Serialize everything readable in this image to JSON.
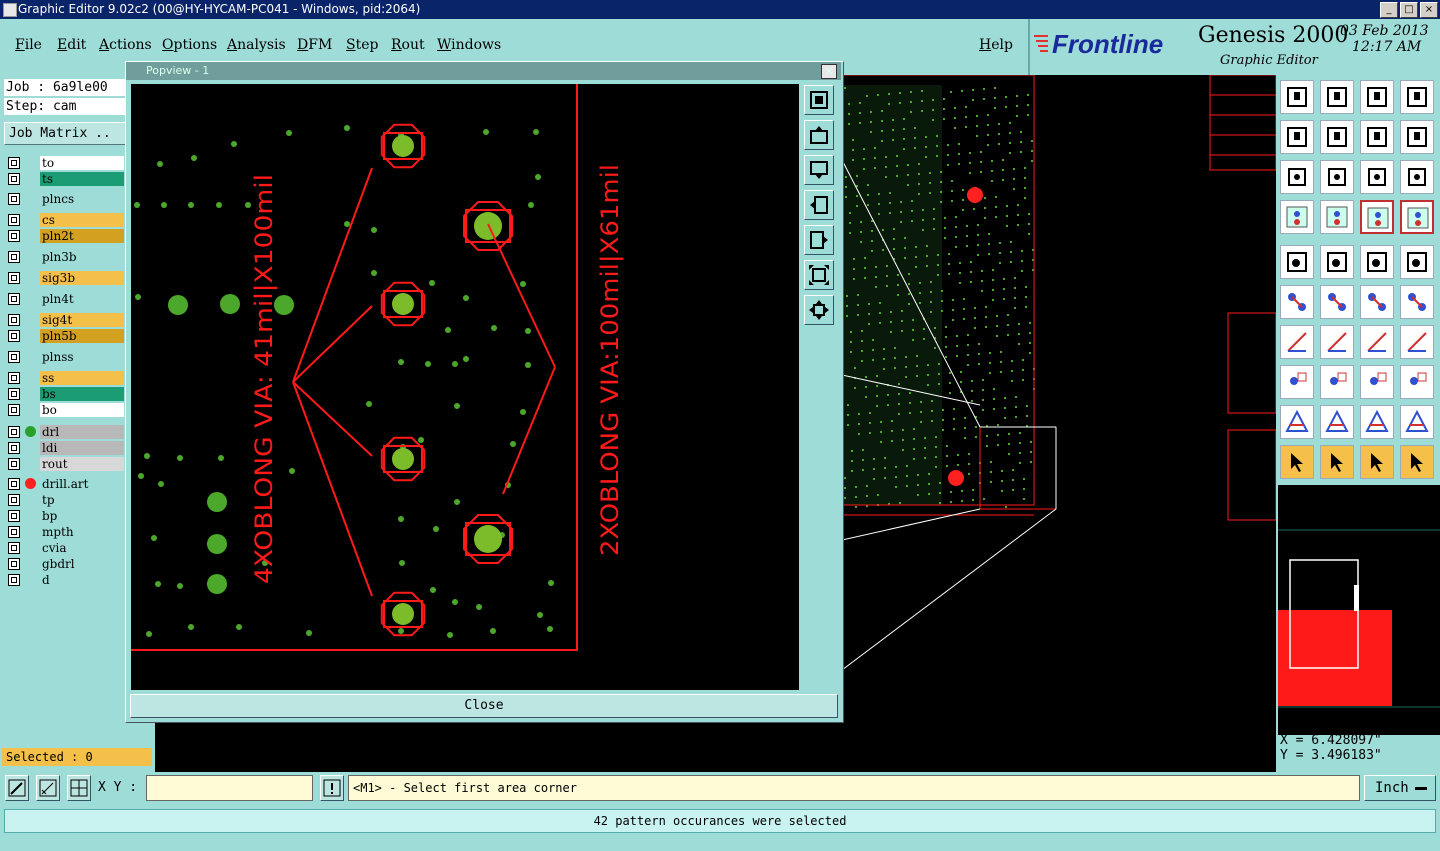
{
  "window": {
    "title": "Graphic Editor 9.02c2 (00@HY-HYCAM-PC041 - Windows, pid:2064)",
    "controls": [
      "_",
      "□",
      "×"
    ]
  },
  "menu": {
    "items": [
      "File",
      "Edit",
      "Actions",
      "Options",
      "Analysis",
      "DFM",
      "Step",
      "Rout",
      "Windows"
    ],
    "help": "Help"
  },
  "brand": {
    "logo": "Frontline",
    "product": "Genesis 2000",
    "subtitle": "Graphic Editor",
    "date": "03 Feb 2013",
    "time": "12:17 AM"
  },
  "left": {
    "job": "Job : 6a9le00",
    "step": "Step: cam",
    "job_matrix": "Job Matrix ..",
    "layers": [
      {
        "name": "to",
        "color": "#ffffff",
        "dot": ""
      },
      {
        "name": "ts",
        "color": "#1c9c74",
        "dot": ""
      },
      {
        "name": "plncs",
        "color": "#9edcd8",
        "dot": ""
      },
      {
        "name": "cs",
        "color": "#f5c04a",
        "dot": ""
      },
      {
        "name": "pln2t",
        "color": "#d4a020",
        "dot": ""
      },
      {
        "name": "pln3b",
        "color": "#9edcd8",
        "dot": ""
      },
      {
        "name": "sig3b",
        "color": "#f5c04a",
        "dot": ""
      },
      {
        "name": "pln4t",
        "color": "#9edcd8",
        "dot": ""
      },
      {
        "name": "sig4t",
        "color": "#f5c04a",
        "dot": ""
      },
      {
        "name": "pln5b",
        "color": "#d4a020",
        "dot": ""
      },
      {
        "name": "plnss",
        "color": "#9edcd8",
        "dot": ""
      },
      {
        "name": "ss",
        "color": "#f5c04a",
        "dot": ""
      },
      {
        "name": "bs",
        "color": "#1c9c74",
        "dot": ""
      },
      {
        "name": "bo",
        "color": "#ffffff",
        "dot": ""
      },
      {
        "name": "drl",
        "color": "#b8b8b8",
        "dot": "#2aa02a"
      },
      {
        "name": "ldi",
        "color": "#b8b8b8",
        "dot": ""
      },
      {
        "name": "rout",
        "color": "#d8d8d8",
        "dot": ""
      },
      {
        "name": "drill.art",
        "color": "#9edcd8",
        "dot": "#ff2020"
      },
      {
        "name": "tp",
        "color": "#9edcd8",
        "dot": ""
      },
      {
        "name": "bp",
        "color": "#9edcd8",
        "dot": ""
      },
      {
        "name": "mpth",
        "color": "#9edcd8",
        "dot": ""
      },
      {
        "name": "cvia",
        "color": "#9edcd8",
        "dot": ""
      },
      {
        "name": "gbdrl",
        "color": "#9edcd8",
        "dot": ""
      },
      {
        "name": "d",
        "color": "#9edcd8",
        "dot": ""
      }
    ],
    "selected": "Selected : 0"
  },
  "popview": {
    "title": "Popview - 1",
    "close": "Close",
    "annotation_left": "4XOBLONG VIA: 41mil|X100mil",
    "annotation_right": "2XOBLONG VIA:100mil|X61mil"
  },
  "right": {
    "x": "X = 6.428097\"",
    "y": "Y = 3.496183\""
  },
  "bottom": {
    "xy_label": "X Y :",
    "xy_value": "",
    "prompt": "<M1> - Select first area corner",
    "unit": "Inch",
    "status": "42 pattern occurances were selected"
  },
  "colors": {
    "panel": "#9edcd8",
    "trace": "#ff1a1a",
    "pad": "#4ca82a",
    "titlebar": "#0a246a"
  }
}
